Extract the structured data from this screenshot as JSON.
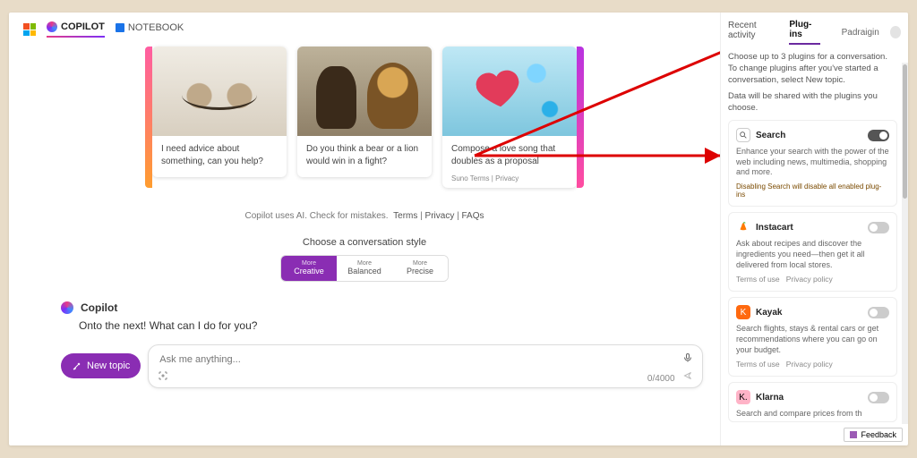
{
  "nav": {
    "copilot": "COPILOT",
    "notebook": "NOTEBOOK"
  },
  "cards": [
    {
      "prompt": "I need advice about something, can you help?"
    },
    {
      "prompt": "Do you think a bear or a lion would win in a fight?"
    },
    {
      "prompt": "Compose a love song that doubles as a proposal",
      "sub": "Suno  Terms | Privacy"
    }
  ],
  "disclaimer": {
    "text": "Copilot uses AI. Check for mistakes.",
    "terms": "Terms",
    "privacy": "Privacy",
    "faqs": "FAQs"
  },
  "style": {
    "label": "Choose a conversation style",
    "more": "More",
    "creative": "Creative",
    "balanced": "Balanced",
    "precise": "Precise"
  },
  "chat": {
    "brand": "Copilot",
    "greeting": "Onto the next! What can I do for you?",
    "new_topic": "New topic",
    "placeholder": "Ask me anything...",
    "counter": "0/4000"
  },
  "sidebar": {
    "tabs": {
      "recent": "Recent activity",
      "plugins": "Plug-ins"
    },
    "user": "Padraigin",
    "intro1": "Choose up to 3 plugins for a conversation. To change plugins after you've started a conversation, select New topic.",
    "intro2": "Data will be shared with the plugins you choose.",
    "tou": "Terms of use",
    "pp": "Privacy policy",
    "plugins": [
      {
        "name": "Search",
        "desc": "Enhance your search with the power of the web including news, multimedia, shopping and more.",
        "note": "Disabling Search will disable all enabled plug-ins",
        "on": true
      },
      {
        "name": "Instacart",
        "desc": "Ask about recipes and discover the ingredients you need—then get it all delivered from local stores.",
        "on": false
      },
      {
        "name": "Kayak",
        "desc": "Search flights, stays & rental cars or get recommendations where you can go on your budget.",
        "on": false
      },
      {
        "name": "Klarna",
        "desc": "Search and compare prices from th",
        "on": false
      }
    ],
    "feedback": "Feedback"
  }
}
